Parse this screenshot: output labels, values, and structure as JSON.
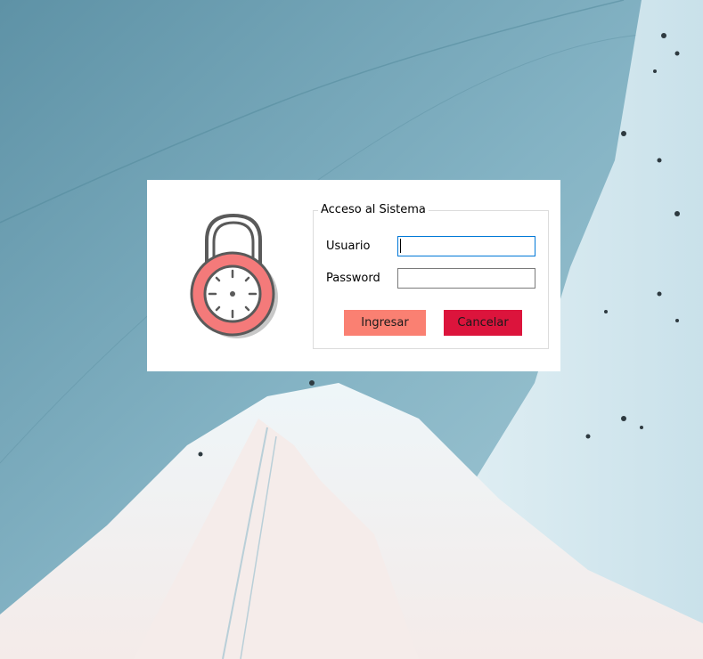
{
  "dialog": {
    "group_title": "Acceso al Sistema",
    "usuario_label": "Usuario",
    "usuario_value": "",
    "password_label": "Password",
    "password_value": "",
    "ingresar_label": "Ingresar",
    "cancelar_label": "Cancelar",
    "lock_icon": "padlock-icon"
  },
  "colors": {
    "ingresar_bg": "#fa8072",
    "cancelar_bg": "#dc143c",
    "lock_body": "#f47a7a",
    "lock_outline": "#5a5a5a",
    "dialog_bg": "#ffffff",
    "focus_border": "#0078d7"
  }
}
